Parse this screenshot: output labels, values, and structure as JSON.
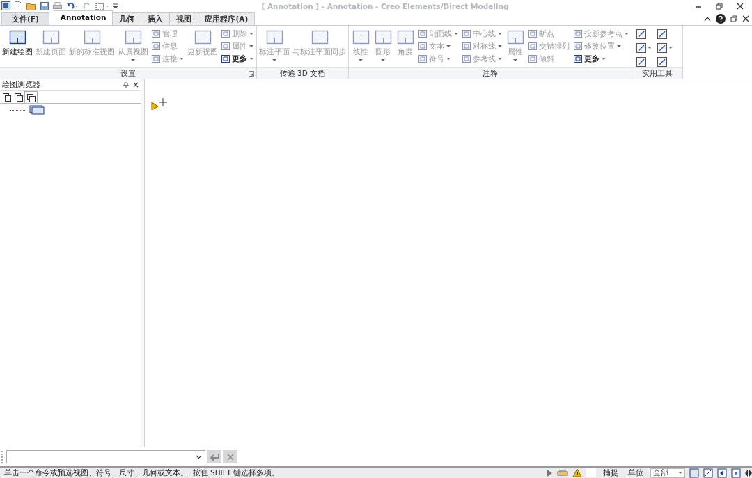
{
  "window": {
    "title": "[ Annotation ] - Annotation - Creo Elements/Direct Modeling"
  },
  "tabs": [
    {
      "label": "文件(F)",
      "kind": "file",
      "selected": false
    },
    {
      "label": "Annotation",
      "kind": "tab",
      "selected": true
    },
    {
      "label": "几何",
      "kind": "tab",
      "selected": false
    },
    {
      "label": "插入",
      "kind": "tab",
      "selected": false
    },
    {
      "label": "视图",
      "kind": "tab",
      "selected": false
    },
    {
      "label": "应用程序(A)",
      "kind": "tab",
      "selected": false
    }
  ],
  "ribbon": [
    {
      "label": "设置",
      "launcher": true,
      "items": [
        {
          "kind": "large",
          "label": "新建绘图",
          "disabled": false,
          "dropdown": false
        },
        {
          "kind": "large",
          "label": "新建页面",
          "disabled": true,
          "dropdown": false
        },
        {
          "kind": "large",
          "label": "新的标准视图",
          "disabled": true,
          "dropdown": false
        },
        {
          "kind": "large",
          "label": "从属视图",
          "disabled": true,
          "dropdown": true
        },
        {
          "kind": "column",
          "entries": [
            {
              "label": "管理",
              "disabled": true,
              "dropdown": false
            },
            {
              "label": "信息",
              "disabled": true,
              "dropdown": false
            },
            {
              "label": "连接",
              "disabled": true,
              "dropdown": true
            }
          ]
        },
        {
          "kind": "large",
          "label": "更新视图",
          "disabled": true,
          "dropdown": false
        },
        {
          "kind": "column",
          "entries": [
            {
              "label": "删除",
              "disabled": true,
              "dropdown": true
            },
            {
              "label": "属性",
              "disabled": true,
              "dropdown": true
            },
            {
              "label": "更多",
              "disabled": false,
              "dropdown": true
            }
          ]
        }
      ]
    },
    {
      "label": "传递 3D 文档",
      "launcher": false,
      "items": [
        {
          "kind": "large",
          "label": "标注平面",
          "disabled": true,
          "dropdown": true
        },
        {
          "kind": "large",
          "label": "与标注平面同步",
          "disabled": true,
          "dropdown": false
        }
      ]
    },
    {
      "label": "注释",
      "launcher": false,
      "items": [
        {
          "kind": "large",
          "label": "线性",
          "disabled": true,
          "dropdown": true
        },
        {
          "kind": "large",
          "label": "圆形",
          "disabled": true,
          "dropdown": true
        },
        {
          "kind": "large",
          "label": "角度",
          "disabled": true,
          "dropdown": false
        },
        {
          "kind": "column",
          "entries": [
            {
              "label": "剖面线",
              "disabled": true,
              "dropdown": true
            },
            {
              "label": "文本",
              "disabled": true,
              "dropdown": true
            },
            {
              "label": "符号",
              "disabled": true,
              "dropdown": true
            }
          ]
        },
        {
          "kind": "column",
          "entries": [
            {
              "label": "中心线",
              "disabled": true,
              "dropdown": true
            },
            {
              "label": "对称线",
              "disabled": true,
              "dropdown": true
            },
            {
              "label": "参考线",
              "disabled": true,
              "dropdown": true
            }
          ]
        },
        {
          "kind": "large",
          "label": "属性",
          "disabled": true,
          "dropdown": true
        },
        {
          "kind": "column",
          "entries": [
            {
              "label": "断点",
              "disabled": true,
              "dropdown": false
            },
            {
              "label": "交错排列",
              "disabled": true,
              "dropdown": false
            },
            {
              "label": "倾斜",
              "disabled": true,
              "dropdown": false
            }
          ]
        },
        {
          "kind": "column",
          "entries": [
            {
              "label": "投影参考点",
              "disabled": true,
              "dropdown": true
            },
            {
              "label": "修改位置",
              "disabled": true,
              "dropdown": true
            },
            {
              "label": "更多",
              "disabled": false,
              "dropdown": true
            }
          ]
        }
      ]
    },
    {
      "label": "实用工具",
      "launcher": false,
      "items": [
        {
          "kind": "tools",
          "entries": [
            {
              "dropdown": false
            },
            {
              "dropdown": false
            },
            {
              "dropdown": true
            },
            {
              "dropdown": true
            },
            {
              "dropdown": false
            },
            {
              "dropdown": false
            }
          ]
        }
      ]
    }
  ],
  "browser": {
    "title": "绘图浏览器",
    "tabs": [
      {
        "selected": false
      },
      {
        "selected": false
      },
      {
        "selected": true
      }
    ]
  },
  "command_line": {
    "enter_disabled": true,
    "cancel_disabled": true
  },
  "status_bar": {
    "message": "单击一个命令或预选视图、符号、尺寸、几何或文本。. 按住 SHIFT 键选择多项。",
    "snap": "捕捉",
    "units": "单位",
    "filter": "全部"
  }
}
